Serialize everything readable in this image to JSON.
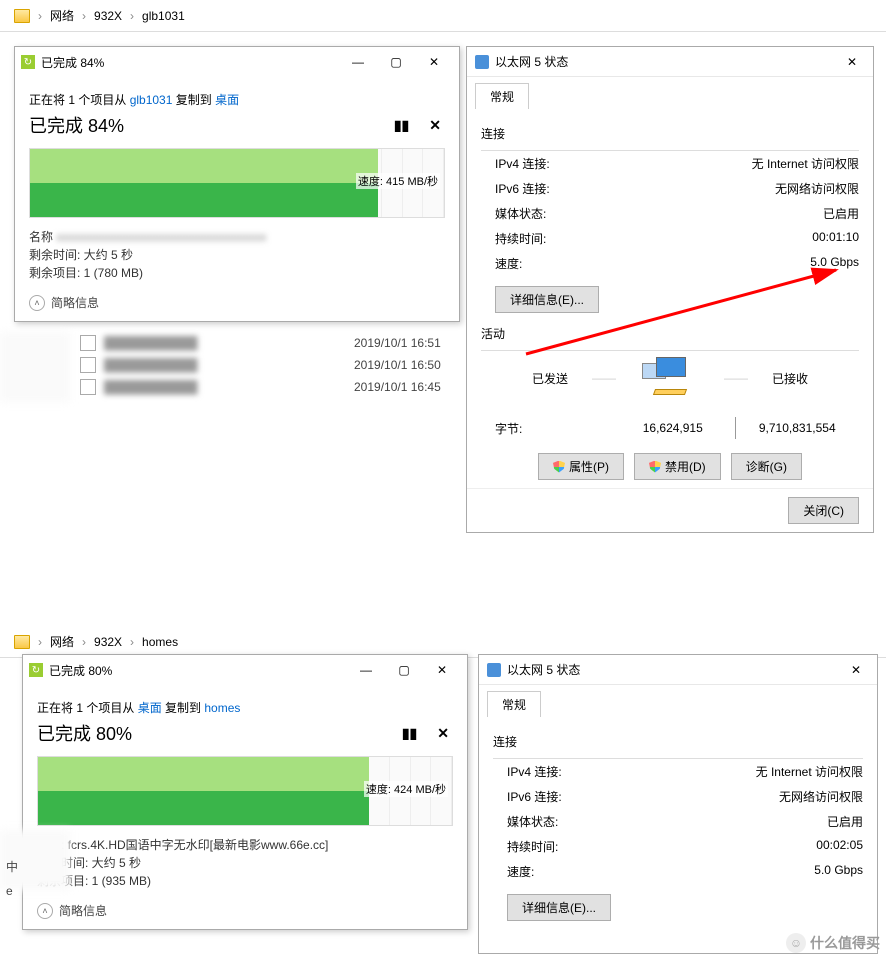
{
  "top": {
    "breadcrumb": {
      "parts": [
        "网络",
        "932X",
        "glb1031"
      ]
    },
    "copy": {
      "title": "已完成 84%",
      "src_prefix": "正在将 1 个项目从 ",
      "src_link": "glb1031",
      "src_mid": " 复制到 ",
      "dst_link": "桌面",
      "heading": "已完成 84%",
      "percent": 84,
      "speed": "速度: 415 MB/秒",
      "name_label": "名称",
      "name_value": "",
      "time_label": "剩余时间: 大约 5 秒",
      "items_label": "剩余项目: 1 (780 MB)",
      "collapse": "简略信息"
    },
    "files": [
      {
        "name": "████████████",
        "date": "2019/10/1 16:51"
      },
      {
        "name": "████████████",
        "date": "2019/10/1 16:50"
      },
      {
        "name": "████████████",
        "date": "2019/10/1 16:45"
      }
    ],
    "status": {
      "title": "以太网 5 状态",
      "tab": "常规",
      "conn_label": "连接",
      "ipv4_label": "IPv4 连接:",
      "ipv4_value": "无 Internet 访问权限",
      "ipv6_label": "IPv6 连接:",
      "ipv6_value": "无网络访问权限",
      "media_label": "媒体状态:",
      "media_value": "已启用",
      "dur_label": "持续时间:",
      "dur_value": "00:01:10",
      "speed_label": "速度:",
      "speed_value": "5.0 Gbps",
      "details_btn": "详细信息(E)...",
      "activity_label": "活动",
      "sent": "已发送",
      "recv": "已接收",
      "bytes_label": "字节:",
      "bytes_sent": "16,624,915",
      "bytes_recv": "9,710,831,554",
      "props_btn": "属性(P)",
      "disable_btn": "禁用(D)",
      "diag_btn": "诊断(G)",
      "close_btn": "关闭(C)"
    }
  },
  "bottom": {
    "breadcrumb": {
      "parts": [
        "网络",
        "932X",
        "homes"
      ]
    },
    "copy": {
      "title": "已完成 80%",
      "src_prefix": "正在将 1 个项目从 ",
      "src_link": "桌面",
      "src_mid": " 复制到 ",
      "dst_link": "homes",
      "heading": "已完成 80%",
      "percent": 80,
      "speed": "速度: 424 MB/秒",
      "name_label": "名称: fcrs.4K.HD国语中字无水印[最新电影www.66e.cc]",
      "time_label": "剩余时间: 大约 5 秒",
      "items_label": "剩余项目: 1 (935 MB)",
      "collapse": "简略信息"
    },
    "status": {
      "title": "以太网 5 状态",
      "tab": "常规",
      "conn_label": "连接",
      "ipv4_label": "IPv4 连接:",
      "ipv4_value": "无 Internet 访问权限",
      "ipv6_label": "IPv6 连接:",
      "ipv6_value": "无网络访问权限",
      "media_label": "媒体状态:",
      "media_value": "已启用",
      "dur_label": "持续时间:",
      "dur_value": "00:02:05",
      "speed_label": "速度:",
      "speed_value": "5.0 Gbps",
      "details_btn": "详细信息(E)..."
    }
  },
  "watermark": "什么值得买"
}
